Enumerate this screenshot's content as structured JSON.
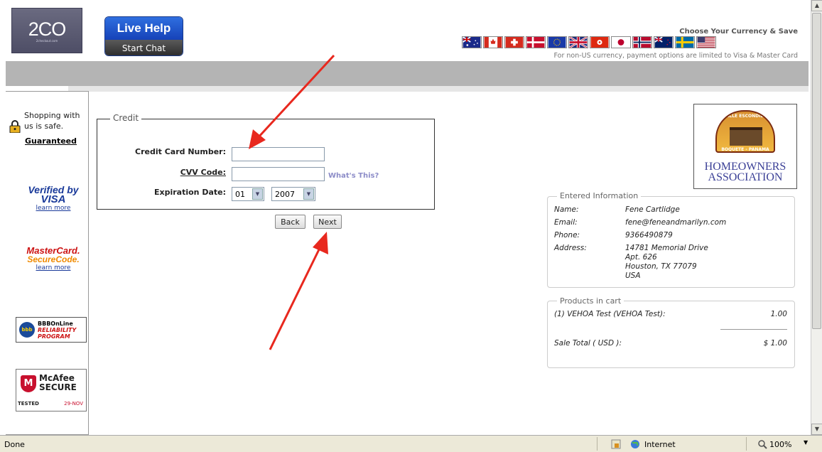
{
  "header": {
    "logo_text": "2CO",
    "logo_subtext": "2checkout.com",
    "live_help_label": "Live Help",
    "start_chat_label": "Start Chat",
    "currency_title": "Choose Your Currency & Save",
    "currency_note": "For non-US currency, payment options are limited to Visa & Master Card",
    "currency_flags": [
      "australia",
      "canada",
      "switzerland",
      "denmark",
      "european-union",
      "united-kingdom",
      "hong-kong",
      "japan",
      "norway",
      "new-zealand",
      "sweden",
      "united-states"
    ]
  },
  "sidebar": {
    "safe_text_line1": "Shopping with",
    "safe_text_line2": "us is safe.",
    "guaranteed": "Guaranteed",
    "vbv_line1": "Verified by",
    "vbv_line2": "VISA",
    "vbv_learn": "learn more",
    "mc_line1": "MasterCard.",
    "mc_line2": "SecureCode.",
    "mc_learn": "learn more",
    "bbb_line1": "BBBOnLine",
    "bbb_line2": "RELIABILITY",
    "bbb_line3": "PROGRAM",
    "mcafee_line1": "McAfee",
    "mcafee_line2": "SECURE",
    "tested": "TESTED",
    "tested_date": "29-NOV"
  },
  "credit": {
    "legend": "Credit",
    "card_number_label": "Credit Card Number:",
    "card_number_value": "",
    "cvv_label": "CVV Code:",
    "cvv_value": "",
    "whats_this": "What's This?",
    "exp_label": "Expiration Date:",
    "exp_month": "01",
    "exp_year": "2007",
    "back_label": "Back",
    "next_label": "Next"
  },
  "merchant": {
    "badge_text": "VALLE ESCONDIDO",
    "badge_subtext": "BOQUETE - PANAMA",
    "name_line1": "HOMEOWNERS",
    "name_line2": "ASSOCIATION"
  },
  "entered_info": {
    "legend": "Entered Information",
    "name_label": "Name:",
    "name_value": "Fene Cartlidge",
    "email_label": "Email:",
    "email_value": "fene@feneandmarilyn.com",
    "phone_label": "Phone:",
    "phone_value": "9366490879",
    "address_label": "Address:",
    "address_line1": "14781 Memorial Drive",
    "address_line2": "Apt. 626",
    "address_line3": "Houston, TX 77079",
    "address_line4": "USA"
  },
  "cart": {
    "legend": "Products in cart",
    "item_label": "(1) VEHOA Test (VEHOA Test):",
    "item_price": "1.00",
    "total_label": "Sale Total ( USD ):",
    "total_value": "$ 1.00"
  },
  "statusbar": {
    "status": "Done",
    "zone": "Internet",
    "zoom": "100%"
  },
  "colors": {
    "annotation_arrow": "#e8281e",
    "header_bar": "#b4b4b4",
    "link_purple": "#8c8cc8"
  }
}
